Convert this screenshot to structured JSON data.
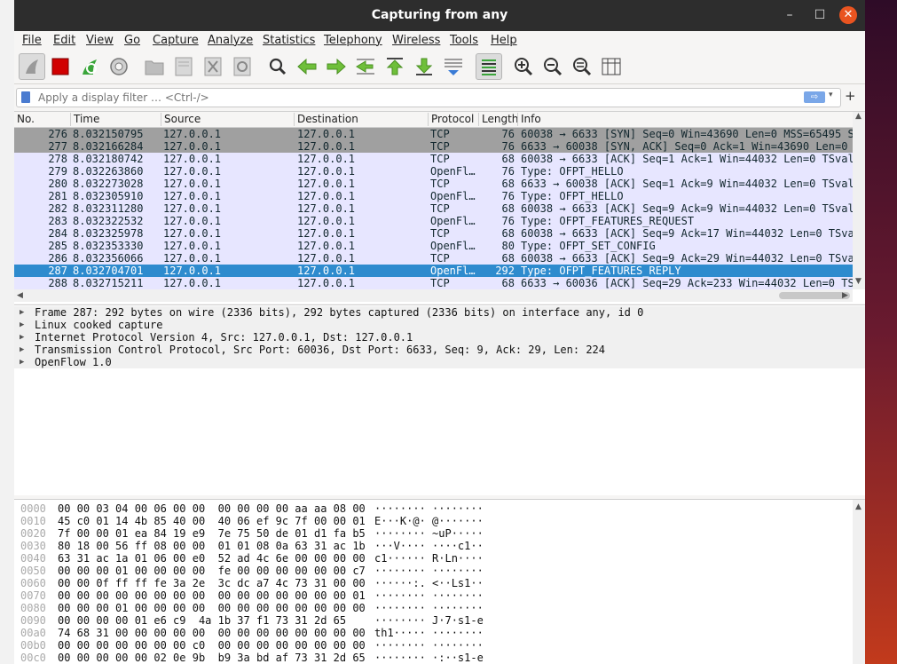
{
  "window": {
    "title": "Capturing from any",
    "minimize": "–",
    "maximize": "☐",
    "close": "✕"
  },
  "menu": [
    "File",
    "Edit",
    "View",
    "Go",
    "Capture",
    "Analyze",
    "Statistics",
    "Telephony",
    "Wireless",
    "Tools",
    "Help"
  ],
  "filter": {
    "placeholder": "Apply a display filter … <Ctrl-/>",
    "apply": "⇨",
    "dropdown": "▾",
    "add": "+"
  },
  "columns": [
    "No.",
    "Time",
    "Source",
    "Destination",
    "Protocol",
    "Length",
    "Info"
  ],
  "packets": [
    {
      "no": "276",
      "time": "8.032150795",
      "src": "127.0.0.1",
      "dst": "127.0.0.1",
      "proto": "TCP",
      "len": "76",
      "info": "60038 → 6633 [SYN] Seq=0 Win=43690 Len=0 MSS=65495 S",
      "style": "tcp-syn"
    },
    {
      "no": "277",
      "time": "8.032166284",
      "src": "127.0.0.1",
      "dst": "127.0.0.1",
      "proto": "TCP",
      "len": "76",
      "info": "6633 → 60038 [SYN, ACK] Seq=0 Ack=1 Win=43690 Len=0",
      "style": "tcp-syn"
    },
    {
      "no": "278",
      "time": "8.032180742",
      "src": "127.0.0.1",
      "dst": "127.0.0.1",
      "proto": "TCP",
      "len": "68",
      "info": "60038 → 6633 [ACK] Seq=1 Ack=1 Win=44032 Len=0 TSval",
      "style": "normal"
    },
    {
      "no": "279",
      "time": "8.032263860",
      "src": "127.0.0.1",
      "dst": "127.0.0.1",
      "proto": "OpenFl…",
      "len": "76",
      "info": "Type: OFPT_HELLO",
      "style": "normal"
    },
    {
      "no": "280",
      "time": "8.032273028",
      "src": "127.0.0.1",
      "dst": "127.0.0.1",
      "proto": "TCP",
      "len": "68",
      "info": "6633 → 60038 [ACK] Seq=1 Ack=9 Win=44032 Len=0 TSval",
      "style": "normal"
    },
    {
      "no": "281",
      "time": "8.032305910",
      "src": "127.0.0.1",
      "dst": "127.0.0.1",
      "proto": "OpenFl…",
      "len": "76",
      "info": "Type: OFPT_HELLO",
      "style": "normal"
    },
    {
      "no": "282",
      "time": "8.032311280",
      "src": "127.0.0.1",
      "dst": "127.0.0.1",
      "proto": "TCP",
      "len": "68",
      "info": "60038 → 6633 [ACK] Seq=9 Ack=9 Win=44032 Len=0 TSval",
      "style": "normal"
    },
    {
      "no": "283",
      "time": "8.032322532",
      "src": "127.0.0.1",
      "dst": "127.0.0.1",
      "proto": "OpenFl…",
      "len": "76",
      "info": "Type: OFPT_FEATURES_REQUEST",
      "style": "normal"
    },
    {
      "no": "284",
      "time": "8.032325978",
      "src": "127.0.0.1",
      "dst": "127.0.0.1",
      "proto": "TCP",
      "len": "68",
      "info": "60038 → 6633 [ACK] Seq=9 Ack=17 Win=44032 Len=0 TSva",
      "style": "normal"
    },
    {
      "no": "285",
      "time": "8.032353330",
      "src": "127.0.0.1",
      "dst": "127.0.0.1",
      "proto": "OpenFl…",
      "len": "80",
      "info": "Type: OFPT_SET_CONFIG",
      "style": "normal"
    },
    {
      "no": "286",
      "time": "8.032356066",
      "src": "127.0.0.1",
      "dst": "127.0.0.1",
      "proto": "TCP",
      "len": "68",
      "info": "60038 → 6633 [ACK] Seq=9 Ack=29 Win=44032 Len=0 TSva",
      "style": "normal"
    },
    {
      "no": "287",
      "time": "8.032704701",
      "src": "127.0.0.1",
      "dst": "127.0.0.1",
      "proto": "OpenFl…",
      "len": "292",
      "info": "Type: OFPT_FEATURES_REPLY",
      "style": "selected"
    },
    {
      "no": "288",
      "time": "8.032715211",
      "src": "127.0.0.1",
      "dst": "127.0.0.1",
      "proto": "TCP",
      "len": "68",
      "info": "6633 → 60036 [ACK] Seq=29 Ack=233 Win=44032 Len=0 TS",
      "style": "normal"
    }
  ],
  "details": [
    "Frame 287: 292 bytes on wire (2336 bits), 292 bytes captured (2336 bits) on interface any, id 0",
    "Linux cooked capture",
    "Internet Protocol Version 4, Src: 127.0.0.1, Dst: 127.0.0.1",
    "Transmission Control Protocol, Src Port: 60036, Dst Port: 6633, Seq: 9, Ack: 29, Len: 224",
    "OpenFlow 1.0"
  ],
  "bytes": [
    {
      "off": "0000",
      "hex": "00 00 03 04 00 06 00 00  00 00 00 00 aa aa 08 00",
      "asc": "········ ········"
    },
    {
      "off": "0010",
      "hex": "45 c0 01 14 4b 85 40 00  40 06 ef 9c 7f 00 00 01",
      "asc": "E···K·@· @·······"
    },
    {
      "off": "0020",
      "hex": "7f 00 00 01 ea 84 19 e9  7e 75 50 de 01 d1 fa b5",
      "asc": "········ ~uP·····"
    },
    {
      "off": "0030",
      "hex": "80 18 00 56 ff 08 00 00  01 01 08 0a 63 31 ac 1b",
      "asc": "···V···· ····c1··"
    },
    {
      "off": "0040",
      "hex": "63 31 ac 1a 01 06 00 e0  52 ad 4c 6e 00 00 00 00",
      "asc": "c1······ R·Ln····"
    },
    {
      "off": "0050",
      "hex": "00 00 00 01 00 00 00 00  fe 00 00 00 00 00 00 c7",
      "asc": "········ ········"
    },
    {
      "off": "0060",
      "hex": "00 00 0f ff ff fe 3a 2e  3c dc a7 4c 73 31 00 00",
      "asc": "······:. <··Ls1··"
    },
    {
      "off": "0070",
      "hex": "00 00 00 00 00 00 00 00  00 00 00 00 00 00 00 01",
      "asc": "········ ········"
    },
    {
      "off": "0080",
      "hex": "00 00 00 01 00 00 00 00  00 00 00 00 00 00 00 00",
      "asc": "········ ········"
    },
    {
      "off": "0090",
      "hex": "00 00 00 00 01 e6 c9  4a 1b 37 f1 73 31 2d 65",
      "asc": "········ J·7·s1-e"
    },
    {
      "off": "00a0",
      "hex": "74 68 31 00 00 00 00 00  00 00 00 00 00 00 00 00",
      "asc": "th1····· ········"
    },
    {
      "off": "00b0",
      "hex": "00 00 00 00 00 00 00 c0  00 00 00 00 00 00 00 00",
      "asc": "········ ········"
    },
    {
      "off": "00c0",
      "hex": "00 00 00 00 00 02 0e 9b  b9 3a bd af 73 31 2d 65",
      "asc": "········ ·:··s1-e"
    }
  ],
  "colors": {
    "selected": "#2e8bce",
    "syn": "#a0a0a0",
    "tcp_row": "#e7e6ff",
    "titlebar": "#2d2d2d",
    "close": "#e95420"
  },
  "toolbar_icons": [
    "shark-fin-start-icon",
    "stop-capture-icon",
    "restart-capture-icon",
    "capture-options-icon",
    "open-file-icon",
    "save-file-icon",
    "close-file-icon",
    "reload-file-icon",
    "find-packet-icon",
    "go-back-icon",
    "go-forward-icon",
    "go-to-packet-icon",
    "first-packet-icon",
    "last-packet-icon",
    "autoscroll-icon",
    "colorize-icon",
    "zoom-in-icon",
    "zoom-out-icon",
    "normal-size-icon",
    "resize-columns-icon"
  ]
}
